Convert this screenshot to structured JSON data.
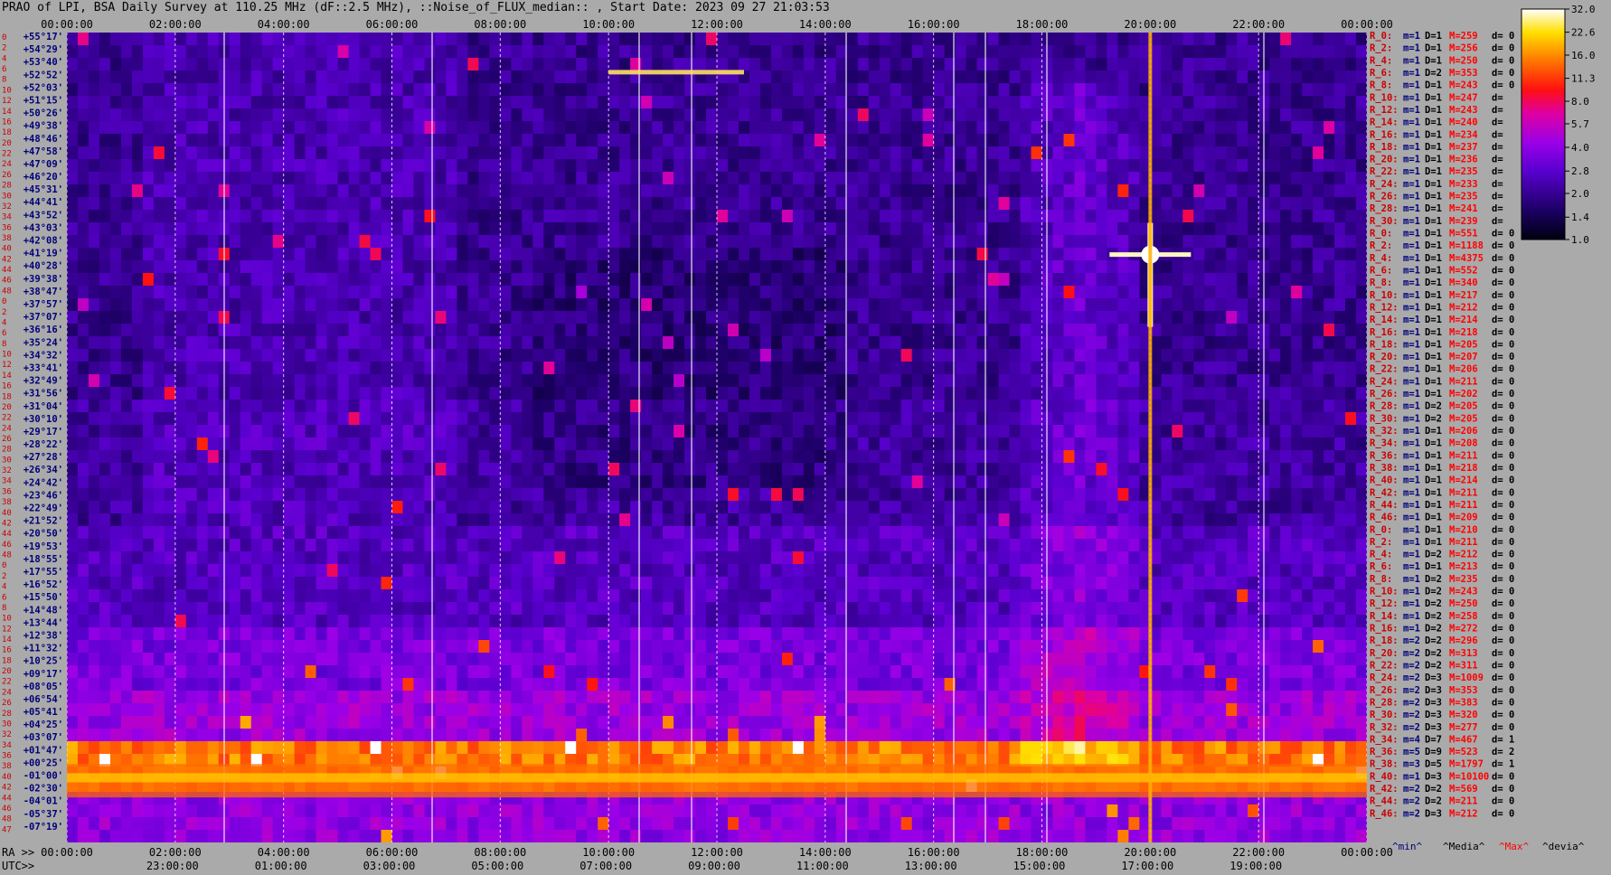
{
  "chart_data": {
    "type": "heatmap",
    "title": "PRAO of LPI, BSA Daily Survey at 110.25 MHz (dF::2.5 MHz), ::Noise_of_FLUX_median:: , Start Date: 2023 09 27 21:03:53",
    "x_top_ticks": [
      "00:00:00",
      "02:00:00",
      "04:00:00",
      "06:00:00",
      "08:00:00",
      "10:00:00",
      "12:00:00",
      "14:00:00",
      "16:00:00",
      "18:00:00",
      "20:00:00",
      "22:00:00",
      "00:00:00"
    ],
    "x_bottom_ra_label": "RA >>",
    "x_bottom_ra_ticks": [
      "00:00:00",
      "02:00:00",
      "04:00:00",
      "06:00:00",
      "08:00:00",
      "10:00:00",
      "12:00:00",
      "14:00:00",
      "16:00:00",
      "18:00:00",
      "20:00:00",
      "22:00:00",
      "00:00:00"
    ],
    "x_bottom_utc_label": "UTC>>",
    "x_bottom_utc_ticks": [
      "23:00:00",
      "01:00:00",
      "03:00:00",
      "05:00:00",
      "07:00:00",
      "09:00:00",
      "11:00:00",
      "13:00:00",
      "15:00:00",
      "17:00:00",
      "19:00:00"
    ],
    "row_indices": [
      "0",
      "2",
      "4",
      "6",
      "8",
      "10",
      "12",
      "14",
      "16",
      "18",
      "20",
      "22",
      "24",
      "26",
      "28",
      "30",
      "32",
      "34",
      "36",
      "38",
      "40",
      "42",
      "44",
      "46",
      "48",
      "0",
      "2",
      "4",
      "6",
      "8",
      "10",
      "12",
      "14",
      "16",
      "18",
      "20",
      "22",
      "24",
      "26",
      "28",
      "30",
      "32",
      "34",
      "36",
      "38",
      "40",
      "42",
      "44",
      "46",
      "48",
      "0",
      "2",
      "4",
      "6",
      "8",
      "10",
      "12",
      "14",
      "16",
      "18",
      "20",
      "22",
      "24",
      "26",
      "28",
      "30",
      "32",
      "34",
      "36",
      "38",
      "40",
      "42",
      "44",
      "46",
      "48",
      "47"
    ],
    "declinations": [
      "+55°17'",
      "+54°29'",
      "+53°40'",
      "+52°52'",
      "+52°03'",
      "+51°15'",
      "+50°26'",
      "+49°38'",
      "+48°46'",
      "+47°58'",
      "+47°09'",
      "+46°20'",
      "+45°31'",
      "+44°41'",
      "+43°52'",
      "+43°03'",
      "+42°08'",
      "+41°19'",
      "+40°28'",
      "+39°38'",
      "+38°47'",
      "+37°57'",
      "+37°07'",
      "+36°16'",
      "+35°24'",
      "+34°32'",
      "+33°41'",
      "+32°49'",
      "+31°56'",
      "+31°04'",
      "+30°10'",
      "+29°17'",
      "+28°22'",
      "+27°28'",
      "+26°34'",
      "+24°42'",
      "+23°46'",
      "+22°49'",
      "+21°52'",
      "+20°50'",
      "+19°53'",
      "+18°55'",
      "+17°55'",
      "+16°52'",
      "+15°50'",
      "+14°48'",
      "+13°44'",
      "+12°38'",
      "+11°32'",
      "+10°25'",
      "+09°17'",
      "+08°05'",
      "+06°54'",
      "+05°41'",
      "+04°25'",
      "+03°07'",
      "+01°47'",
      "+00°25'",
      "-01°00'",
      "-02°30'",
      "-04°01'",
      "-05°37'",
      "-07°19'"
    ],
    "row_stats": [
      {
        "r": "R_0:",
        "m": "m=1",
        "D": "D=1",
        "M": "M=259",
        "d": "d= 0"
      },
      {
        "r": "R_2:",
        "m": "m=1",
        "D": "D=1",
        "M": "M=256",
        "d": "d= 0"
      },
      {
        "r": "R_4:",
        "m": "m=1",
        "D": "D=1",
        "M": "M=250",
        "d": "d= 0"
      },
      {
        "r": "R_6:",
        "m": "m=1",
        "D": "D=2",
        "M": "M=353",
        "d": "d= 0"
      },
      {
        "r": "R_8:",
        "m": "m=1",
        "D": "D=1",
        "M": "M=243",
        "d": "d= 0"
      },
      {
        "r": "R_10:",
        "m": "m=1",
        "D": "D=1",
        "M": "M=247",
        "d": "d="
      },
      {
        "r": "R_12:",
        "m": "m=1",
        "D": "D=1",
        "M": "M=243",
        "d": "d="
      },
      {
        "r": "R_14:",
        "m": "m=1",
        "D": "D=1",
        "M": "M=240",
        "d": "d="
      },
      {
        "r": "R_16:",
        "m": "m=1",
        "D": "D=1",
        "M": "M=234",
        "d": "d="
      },
      {
        "r": "R_18:",
        "m": "m=1",
        "D": "D=1",
        "M": "M=237",
        "d": "d="
      },
      {
        "r": "R_20:",
        "m": "m=1",
        "D": "D=1",
        "M": "M=236",
        "d": "d="
      },
      {
        "r": "R_22:",
        "m": "m=1",
        "D": "D=1",
        "M": "M=235",
        "d": "d="
      },
      {
        "r": "R_24:",
        "m": "m=1",
        "D": "D=1",
        "M": "M=233",
        "d": "d="
      },
      {
        "r": "R_26:",
        "m": "m=1",
        "D": "D=1",
        "M": "M=235",
        "d": "d="
      },
      {
        "r": "R_28:",
        "m": "m=1",
        "D": "D=1",
        "M": "M=241",
        "d": "d="
      },
      {
        "r": "R_30:",
        "m": "m=1",
        "D": "D=1",
        "M": "M=239",
        "d": "d="
      },
      {
        "r": "R_0:",
        "m": "m=1",
        "D": "D=1",
        "M": "M=551",
        "d": "d= 0"
      },
      {
        "r": "R_2:",
        "m": "m=1",
        "D": "D=1",
        "M": "M=1188",
        "d": "d= 0"
      },
      {
        "r": "R_4:",
        "m": "m=1",
        "D": "D=1",
        "M": "M=4375",
        "d": "d= 0"
      },
      {
        "r": "R_6:",
        "m": "m=1",
        "D": "D=1",
        "M": "M=552",
        "d": "d= 0"
      },
      {
        "r": "R_8:",
        "m": "m=1",
        "D": "D=1",
        "M": "M=340",
        "d": "d= 0"
      },
      {
        "r": "R_10:",
        "m": "m=1",
        "D": "D=1",
        "M": "M=217",
        "d": "d= 0"
      },
      {
        "r": "R_12:",
        "m": "m=1",
        "D": "D=1",
        "M": "M=212",
        "d": "d= 0"
      },
      {
        "r": "R_14:",
        "m": "m=1",
        "D": "D=1",
        "M": "M=214",
        "d": "d= 0"
      },
      {
        "r": "R_16:",
        "m": "m=1",
        "D": "D=1",
        "M": "M=218",
        "d": "d= 0"
      },
      {
        "r": "R_18:",
        "m": "m=1",
        "D": "D=1",
        "M": "M=205",
        "d": "d= 0"
      },
      {
        "r": "R_20:",
        "m": "m=1",
        "D": "D=1",
        "M": "M=207",
        "d": "d= 0"
      },
      {
        "r": "R_22:",
        "m": "m=1",
        "D": "D=1",
        "M": "M=206",
        "d": "d= 0"
      },
      {
        "r": "R_24:",
        "m": "m=1",
        "D": "D=1",
        "M": "M=211",
        "d": "d= 0"
      },
      {
        "r": "R_26:",
        "m": "m=1",
        "D": "D=1",
        "M": "M=202",
        "d": "d= 0"
      },
      {
        "r": "R_28:",
        "m": "m=1",
        "D": "D=2",
        "M": "M=205",
        "d": "d= 0"
      },
      {
        "r": "R_30:",
        "m": "m=1",
        "D": "D=2",
        "M": "M=205",
        "d": "d= 0"
      },
      {
        "r": "R_32:",
        "m": "m=1",
        "D": "D=1",
        "M": "M=206",
        "d": "d= 0"
      },
      {
        "r": "R_34:",
        "m": "m=1",
        "D": "D=1",
        "M": "M=208",
        "d": "d= 0"
      },
      {
        "r": "R_36:",
        "m": "m=1",
        "D": "D=1",
        "M": "M=211",
        "d": "d= 0"
      },
      {
        "r": "R_38:",
        "m": "m=1",
        "D": "D=1",
        "M": "M=218",
        "d": "d= 0"
      },
      {
        "r": "R_40:",
        "m": "m=1",
        "D": "D=1",
        "M": "M=214",
        "d": "d= 0"
      },
      {
        "r": "R_42:",
        "m": "m=1",
        "D": "D=1",
        "M": "M=211",
        "d": "d= 0"
      },
      {
        "r": "R_44:",
        "m": "m=1",
        "D": "D=1",
        "M": "M=211",
        "d": "d= 0"
      },
      {
        "r": "R_46:",
        "m": "m=1",
        "D": "D=1",
        "M": "M=209",
        "d": "d= 0"
      },
      {
        "r": "R_0:",
        "m": "m=1",
        "D": "D=1",
        "M": "M=210",
        "d": "d= 0"
      },
      {
        "r": "R_2:",
        "m": "m=1",
        "D": "D=1",
        "M": "M=211",
        "d": "d= 0"
      },
      {
        "r": "R_4:",
        "m": "m=1",
        "D": "D=2",
        "M": "M=212",
        "d": "d= 0"
      },
      {
        "r": "R_6:",
        "m": "m=1",
        "D": "D=1",
        "M": "M=213",
        "d": "d= 0"
      },
      {
        "r": "R_8:",
        "m": "m=1",
        "D": "D=2",
        "M": "M=235",
        "d": "d= 0"
      },
      {
        "r": "R_10:",
        "m": "m=1",
        "D": "D=2",
        "M": "M=243",
        "d": "d= 0"
      },
      {
        "r": "R_12:",
        "m": "m=1",
        "D": "D=2",
        "M": "M=250",
        "d": "d= 0"
      },
      {
        "r": "R_14:",
        "m": "m=1",
        "D": "D=2",
        "M": "M=258",
        "d": "d= 0"
      },
      {
        "r": "R_16:",
        "m": "m=1",
        "D": "D=2",
        "M": "M=272",
        "d": "d= 0"
      },
      {
        "r": "R_18:",
        "m": "m=2",
        "D": "D=2",
        "M": "M=296",
        "d": "d= 0"
      },
      {
        "r": "R_20:",
        "m": "m=2",
        "D": "D=2",
        "M": "M=313",
        "d": "d= 0"
      },
      {
        "r": "R_22:",
        "m": "m=2",
        "D": "D=2",
        "M": "M=311",
        "d": "d= 0"
      },
      {
        "r": "R_24:",
        "m": "m=2",
        "D": "D=3",
        "M": "M=1009",
        "d": "d= 0"
      },
      {
        "r": "R_26:",
        "m": "m=2",
        "D": "D=3",
        "M": "M=353",
        "d": "d= 0"
      },
      {
        "r": "R_28:",
        "m": "m=2",
        "D": "D=3",
        "M": "M=383",
        "d": "d= 0"
      },
      {
        "r": "R_30:",
        "m": "m=2",
        "D": "D=3",
        "M": "M=320",
        "d": "d= 0"
      },
      {
        "r": "R_32:",
        "m": "m=2",
        "D": "D=3",
        "M": "M=277",
        "d": "d= 0"
      },
      {
        "r": "R_34:",
        "m": "m=4",
        "D": "D=7",
        "M": "M=467",
        "d": "d= 1"
      },
      {
        "r": "R_36:",
        "m": "m=5",
        "D": "D=9",
        "M": "M=523",
        "d": "d= 2"
      },
      {
        "r": "R_38:",
        "m": "m=3",
        "D": "D=5",
        "M": "M=1797",
        "d": "d= 1"
      },
      {
        "r": "R_40:",
        "m": "m=1",
        "D": "D=3",
        "M": "M=10100",
        "d": "d= 0"
      },
      {
        "r": "R_42:",
        "m": "m=2",
        "D": "D=2",
        "M": "M=569",
        "d": "d= 0"
      },
      {
        "r": "R_44:",
        "m": "m=2",
        "D": "D=2",
        "M": "M=211",
        "d": "d= 0"
      },
      {
        "r": "R_46:",
        "m": "m=2",
        "D": "D=3",
        "M": "M=212",
        "d": "d= 0"
      }
    ],
    "stats_legend": [
      "^min^",
      "^Media^",
      "^Max^",
      "^devia^"
    ],
    "stats_legend_colors": [
      "#00007a",
      "#000000",
      "#ff0000",
      "#000000"
    ],
    "colorbar_ticks": [
      "32.0",
      "22.6",
      "16.0",
      "11.3",
      "8.0",
      "5.7",
      "4.0",
      "2.8",
      "2.0",
      "1.4",
      "1.0"
    ],
    "colorbar_range": [
      1.0,
      32.0
    ],
    "colorbar_scale": "log",
    "colormap": [
      "#000000",
      "#1a0040",
      "#3a00a0",
      "#7a00e0",
      "#c000c8",
      "#ff1a1a",
      "#ff8000",
      "#ffd000",
      "#ffffff"
    ],
    "features": [
      {
        "kind": "horizontal-band",
        "dec": "+01°47' to -01°00'",
        "level": "high"
      },
      {
        "kind": "bright-source",
        "ra": "20:00:00",
        "dec": "+41°19'",
        "level": "saturated"
      },
      {
        "kind": "vertical-streak",
        "ra": "20:00:00",
        "level": "high"
      },
      {
        "kind": "horizontal-streak",
        "ra": "10:00:00 – 12:30:00",
        "dec": "+52°52'",
        "level": "high"
      }
    ]
  }
}
